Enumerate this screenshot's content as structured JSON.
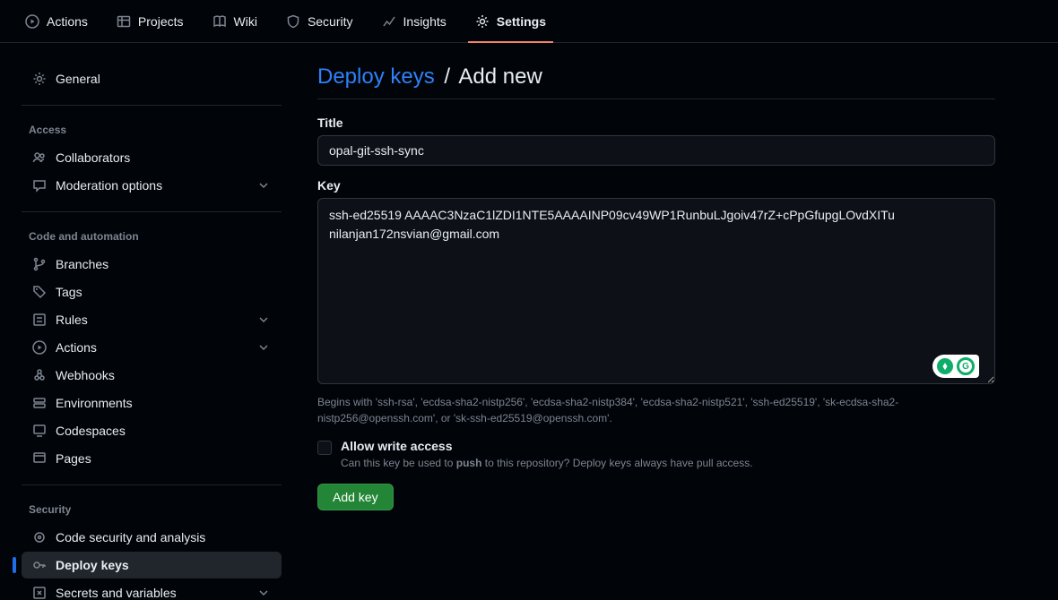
{
  "topnav": [
    {
      "label": "Actions",
      "icon": "play"
    },
    {
      "label": "Projects",
      "icon": "table"
    },
    {
      "label": "Wiki",
      "icon": "book"
    },
    {
      "label": "Security",
      "icon": "shield"
    },
    {
      "label": "Insights",
      "icon": "graph"
    },
    {
      "label": "Settings",
      "icon": "gear",
      "active": true
    }
  ],
  "sidebar": {
    "top": {
      "label": "General",
      "icon": "gear"
    },
    "groups": [
      {
        "header": "Access",
        "items": [
          {
            "label": "Collaborators",
            "icon": "people"
          },
          {
            "label": "Moderation options",
            "icon": "comment",
            "expandable": true
          }
        ]
      },
      {
        "header": "Code and automation",
        "items": [
          {
            "label": "Branches",
            "icon": "branch"
          },
          {
            "label": "Tags",
            "icon": "tag"
          },
          {
            "label": "Rules",
            "icon": "rules",
            "expandable": true
          },
          {
            "label": "Actions",
            "icon": "play",
            "expandable": true
          },
          {
            "label": "Webhooks",
            "icon": "webhook"
          },
          {
            "label": "Environments",
            "icon": "env"
          },
          {
            "label": "Codespaces",
            "icon": "codespaces"
          },
          {
            "label": "Pages",
            "icon": "pages"
          }
        ]
      },
      {
        "header": "Security",
        "items": [
          {
            "label": "Code security and analysis",
            "icon": "scan"
          },
          {
            "label": "Deploy keys",
            "icon": "key",
            "selected": true
          },
          {
            "label": "Secrets and variables",
            "icon": "secret",
            "expandable": true
          }
        ]
      }
    ]
  },
  "breadcrumb": {
    "link": "Deploy keys",
    "sep": "/",
    "current": "Add new"
  },
  "form": {
    "title_label": "Title",
    "title_value": "opal-git-ssh-sync",
    "key_label": "Key",
    "key_value": "ssh-ed25519 AAAAC3NzaC1lZDI1NTE5AAAAINP09cv49WP1RunbuLJgoiv47rZ+cPpGfupgLOvdXITu nilanjan172nsvian@gmail.com",
    "key_hint": "Begins with 'ssh-rsa', 'ecdsa-sha2-nistp256', 'ecdsa-sha2-nistp384', 'ecdsa-sha2-nistp521', 'ssh-ed25519', 'sk-ecdsa-sha2-nistp256@openssh.com', or 'sk-ssh-ed25519@openssh.com'.",
    "checkbox_label": "Allow write access",
    "checkbox_desc_pre": "Can this key be used to ",
    "checkbox_desc_bold": "push",
    "checkbox_desc_post": " to this repository? Deploy keys always have pull access.",
    "submit_label": "Add key"
  }
}
